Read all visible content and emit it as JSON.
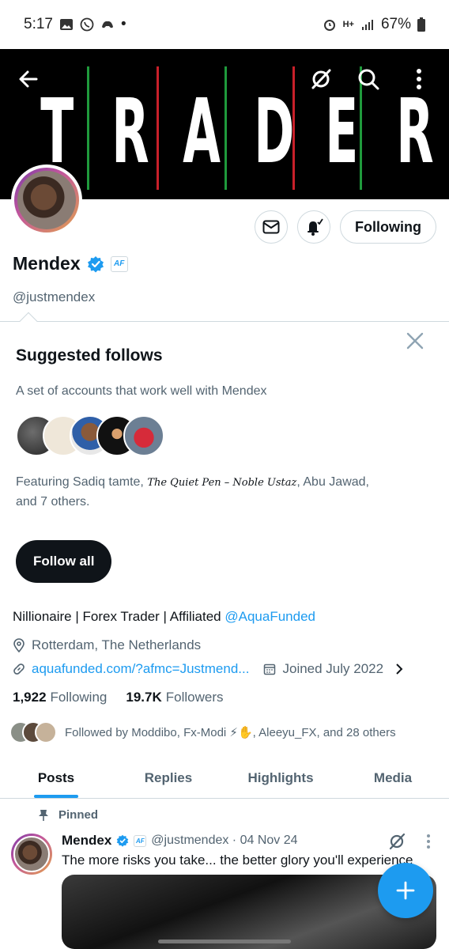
{
  "status_bar": {
    "time": "5:17",
    "dot": "•",
    "network": "H+",
    "battery": "67%"
  },
  "banner": {
    "letters": [
      "T",
      "R",
      "A",
      "D",
      "E",
      "R"
    ],
    "stripe_colors": [
      "#1f9a3c",
      "#c8202a"
    ]
  },
  "profile": {
    "name": "Mendex",
    "handle": "@justmendex",
    "affiliate_badge": "AF",
    "following_button": "Following"
  },
  "suggested": {
    "title": "Suggested follows",
    "subtitle": "A set of accounts that work well with Mendex",
    "featuring_prefix": "Featuring Sadiq tamte, ",
    "featuring_script": "The Quiet Pen – Noble Ustaz",
    "featuring_suffix": ", Abu Jawad,",
    "featuring_line2": "and 7 others.",
    "follow_all": "Follow all"
  },
  "bio": {
    "text": "Nillionaire | Forex Trader | Affiliated ",
    "mention": "@AquaFunded",
    "location": "Rotterdam, The Netherlands",
    "link": "aquafunded.com/?afmc=Justmend...",
    "joined": "Joined July 2022"
  },
  "stats": {
    "following_count": "1,922",
    "following_label": "Following",
    "followers_count": "19.7K",
    "followers_label": "Followers"
  },
  "followed_by": "Followed by Moddibo, Fx-Modi ⚡✋, Aleeyu_FX, and 28 others",
  "tabs": [
    "Posts",
    "Replies",
    "Highlights",
    "Media"
  ],
  "post": {
    "pinned_label": "Pinned",
    "author": "Mendex",
    "handle_date": "@justmendex · 04 Nov 24",
    "text": "The more risks you take... the better glory you'll experience",
    "affiliate_badge": "AF"
  },
  "colors": {
    "accent": "#1d9bf0",
    "text": "#0f1419",
    "muted": "#536471"
  }
}
